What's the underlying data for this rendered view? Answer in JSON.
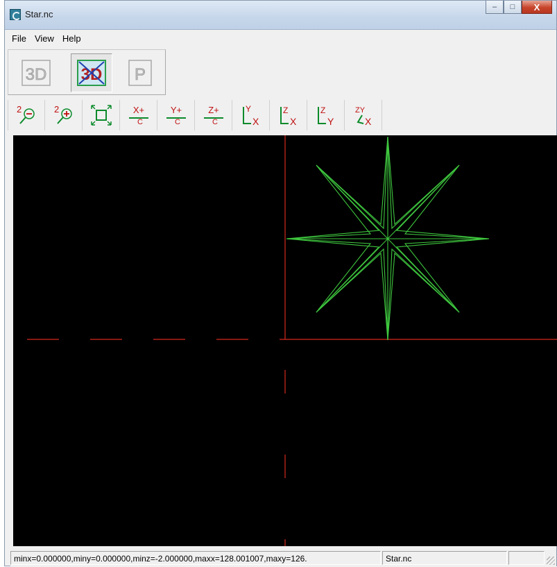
{
  "window": {
    "title": "Star.nc",
    "icon": "app-icon",
    "caption": {
      "minimize": "–",
      "maximize": "□",
      "close": "X"
    }
  },
  "menu": {
    "items": [
      "File",
      "View",
      "Help"
    ]
  },
  "toolbar_top": [
    {
      "name": "3d-view-icon",
      "label": "3D",
      "pressed": false
    },
    {
      "name": "3d-disable-icon",
      "label": "3D",
      "pressed": true
    },
    {
      "name": "parallel-view-icon",
      "label": "P",
      "pressed": false
    }
  ],
  "toolbar_bottom": [
    {
      "name": "zoom-out-icon",
      "sup": "2",
      "glyph": "⊖"
    },
    {
      "name": "zoom-in-icon",
      "sup": "2",
      "glyph": "⊕"
    },
    {
      "name": "fit-view-icon",
      "glyph": "⛶"
    },
    {
      "name": "x-plus-rotate-icon",
      "top": "X+",
      "bottom": "C"
    },
    {
      "name": "y-plus-rotate-icon",
      "top": "Y+",
      "bottom": "C"
    },
    {
      "name": "z-plus-rotate-icon",
      "top": "Z+",
      "bottom": "C"
    },
    {
      "name": "view-xy-icon",
      "a": "Y",
      "b": "X"
    },
    {
      "name": "view-xz-icon",
      "a": "Z",
      "b": "X"
    },
    {
      "name": "view-yz-icon",
      "a": "Z",
      "b": "Y"
    },
    {
      "name": "view-xyz-icon",
      "a": "ZY",
      "b": "X"
    }
  ],
  "status": {
    "coords": "minx=0.000000,miny=0.000000,minz=-2.000000,maxx=128.001007,maxy=126.",
    "file": "Star.nc"
  },
  "colors": {
    "axis": "#d42a1e",
    "toolpath": "#3ec63e",
    "background": "#000000"
  }
}
